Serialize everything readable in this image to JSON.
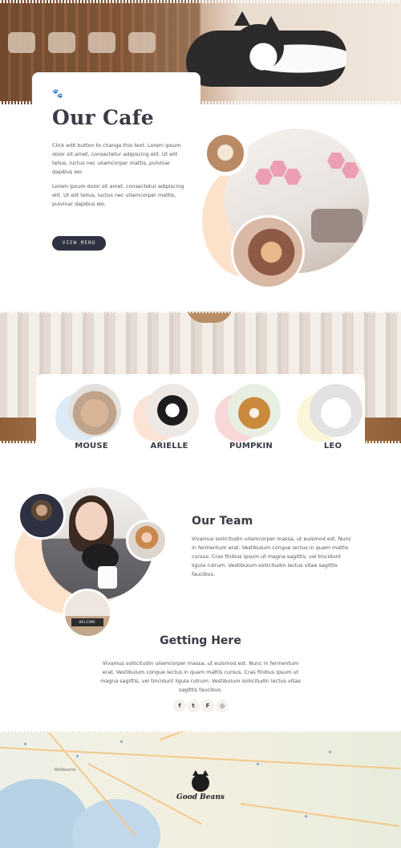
{
  "about": {
    "title": "Our Cafe",
    "paragraph1": "Click edit button to change this text. Lorem ipsum dolor sit amet, consectetur adipiscing elit. Ut elit tellus, luctus nec ullamcorper mattis, pulvinar dapibus leo.",
    "paragraph2": "Lorem ipsum dolor sit amet, consectetur adipiscing elit. Ut elit tellus, luctus nec ullamcorper mattis, pulvinar dapibus leo.",
    "button_label": "VIEW MENU"
  },
  "cats": [
    {
      "name": "MOUSE",
      "accent": "#dcebf6"
    },
    {
      "name": "ARIELLE",
      "accent": "#fbe3d6"
    },
    {
      "name": "PUMPKIN",
      "accent": "#f9d7d7"
    },
    {
      "name": "LEO",
      "accent": "#fbf5d9"
    }
  ],
  "team": {
    "title": "Our Team",
    "text": "Vivamus sollicitudin ullamcorper massa, ut euismod est. Nunc in fermentum erat. Vestibulum congue lectus in quam mattis cursus. Cras finibus ipsum ut magna sagittis, vel tincidunt ligula rutrum. Vestibulum sollicitudin lectus vitae sagittis faucibus.",
    "sign_text": "WELCOME"
  },
  "getting_here": {
    "title": "Getting Here",
    "text": "Vivamus sollicitudin ullamcorper massa, ut euismod est. Nunc in fermentum erat. Vestibulum congue lectus in quam mattis cursus. Cras finibus ipsum ut magna sagittis, vel tincidunt ligula rutrum. Vestibulum sollicitudin lectus vitae sagittis faucibus."
  },
  "social": [
    {
      "icon": "facebook-icon",
      "glyph": "f"
    },
    {
      "icon": "twitter-icon",
      "glyph": "t"
    },
    {
      "icon": "foursquare-icon",
      "glyph": "F"
    },
    {
      "icon": "instagram-icon",
      "glyph": "◎"
    }
  ],
  "map": {
    "city_label": "Melbourne",
    "logo_text": "Good Beans"
  },
  "colors": {
    "accent_peach": "#fde2cb",
    "button_dark": "#2f3240",
    "paw_orange": "#e3975e",
    "text_dark": "#3a3a44"
  }
}
